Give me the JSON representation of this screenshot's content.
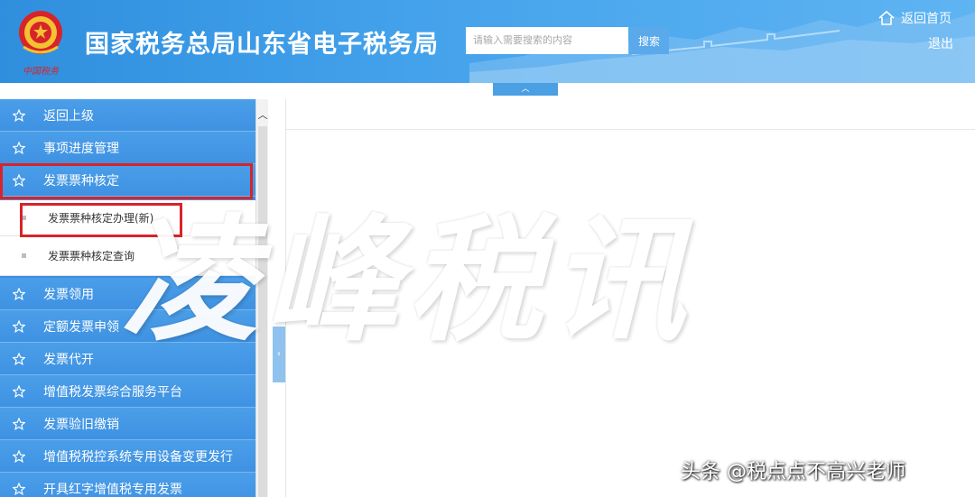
{
  "header": {
    "title": "国家税务总局山东省电子税务局",
    "search_placeholder": "请输入需要搜索的内容",
    "search_button": "搜索",
    "home_link": "返回首页",
    "logout_link": "退出"
  },
  "collapse_tab_icon": "chevron-up-icon",
  "sidebar": {
    "items": [
      {
        "label": "返回上级"
      },
      {
        "label": "事项进度管理"
      },
      {
        "label": "发票票种核定",
        "highlighted": true
      },
      {
        "label": "发票票种核定办理(新)",
        "sub": true,
        "highlighted": true
      },
      {
        "label": "发票票种核定查询",
        "sub": true
      },
      {
        "label": "发票领用"
      },
      {
        "label": "定额发票申领"
      },
      {
        "label": "发票代开"
      },
      {
        "label": "增值税发票综合服务平台"
      },
      {
        "label": "发票验旧缴销"
      },
      {
        "label": "增值税税控系统专用设备变更发行"
      },
      {
        "label": "开具红字增值税专用发票"
      }
    ]
  },
  "content": {
    "watermark": "凌峰税讯"
  },
  "credit": "头条 @税点点不高兴老师",
  "colors": {
    "header_blue": "#3d96e2",
    "sidebar_blue": "#4297e4",
    "highlight_red": "#d8232a"
  }
}
